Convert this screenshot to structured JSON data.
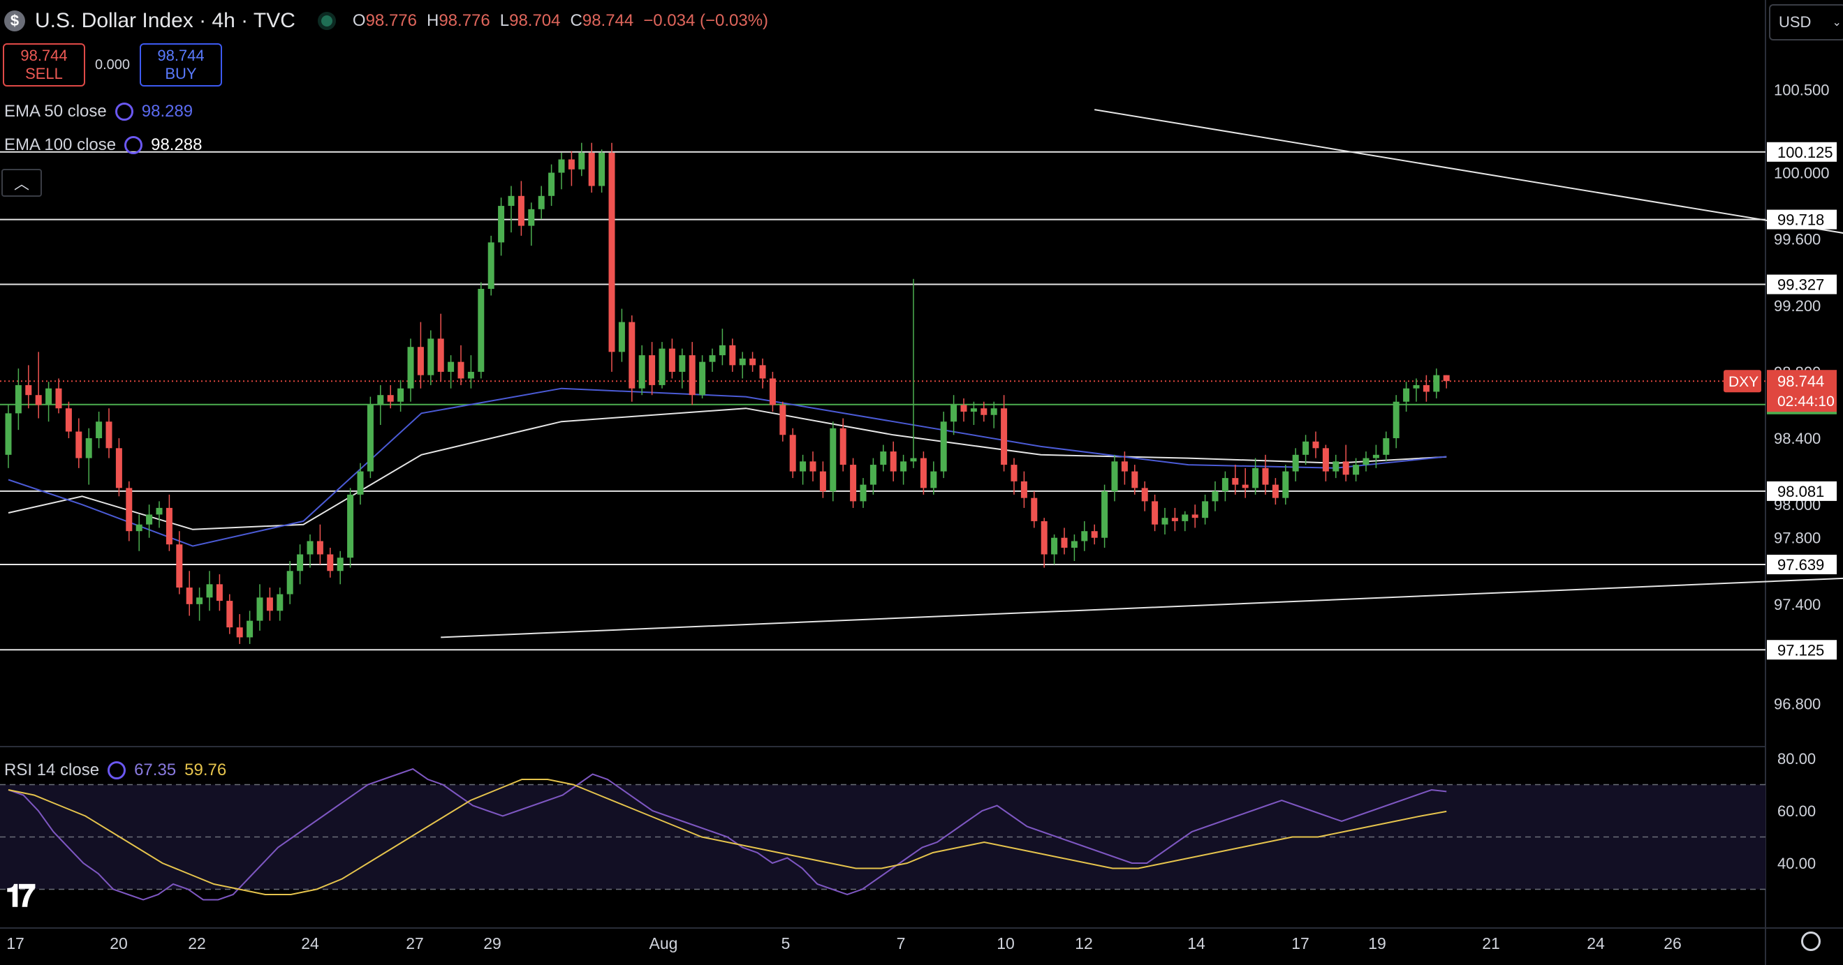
{
  "header": {
    "symbol_icon": "$",
    "title": "U.S. Dollar Index · 4h · TVC",
    "ohlc": {
      "o_label": "O",
      "o": "98.776",
      "h_label": "H",
      "h": "98.776",
      "l_label": "L",
      "l": "98.704",
      "c_label": "C",
      "c": "98.744",
      "change": "−0.034 (−0.03%)"
    }
  },
  "trade": {
    "sell_price": "98.744",
    "sell_label": "SELL",
    "spread": "0.000",
    "buy_price": "98.744",
    "buy_label": "BUY"
  },
  "indicators": {
    "ema50_label": "EMA 50 close",
    "ema50_value": "98.289",
    "ema100_label": "EMA 100 close",
    "ema100_value": "98.288",
    "rsi_label": "RSI 14 close",
    "rsi_value": "67.35",
    "rsi_ma_value": "59.76"
  },
  "currency_selector": "USD",
  "colors": {
    "background": "#000000",
    "up": "#4caf50",
    "down": "#ef5350",
    "ema50": "#4b5bd6",
    "ema100": "#e6e6e6",
    "rsi": "#7e57c2",
    "rsi_ma": "#e6c44d",
    "price_tag": "#e0473f",
    "level_green": "#4caf50"
  },
  "icons": [
    "dollar-icon",
    "market-status-icon",
    "refresh-icon",
    "chevron-up-icon",
    "tradingview-logo-icon",
    "settings-icon",
    "chevron-down-icon"
  ],
  "chart_data": {
    "type": "candlestick",
    "title": "U.S. Dollar Index · 4h · TVC",
    "symbol": "DXY",
    "x_ticks": [
      "17",
      "20",
      "22",
      "24",
      "27",
      "29",
      "Aug",
      "5",
      "7",
      "10",
      "12",
      "14",
      "17",
      "19",
      "21",
      "24",
      "26"
    ],
    "y_ticks": [
      "96.800",
      "97.400",
      "97.800",
      "98.000",
      "98.400",
      "98.800",
      "99.200",
      "99.600",
      "100.000",
      "100.500"
    ],
    "ylim": [
      96.55,
      100.78
    ],
    "horizontal_levels": [
      100.125,
      99.718,
      99.327,
      98.081,
      97.639,
      97.125
    ],
    "support_level_green": 98.603,
    "last_price": 98.744,
    "countdown": "02:44:10",
    "candles": [
      [
        98.3,
        98.6,
        98.22,
        98.55
      ],
      [
        98.55,
        98.82,
        98.45,
        98.72
      ],
      [
        98.72,
        98.84,
        98.58,
        98.66
      ],
      [
        98.66,
        98.92,
        98.52,
        98.6
      ],
      [
        98.6,
        98.74,
        98.5,
        98.7
      ],
      [
        98.7,
        98.76,
        98.55,
        98.58
      ],
      [
        98.58,
        98.62,
        98.4,
        98.44
      ],
      [
        98.44,
        98.52,
        98.22,
        98.28
      ],
      [
        98.28,
        98.46,
        98.12,
        98.4
      ],
      [
        98.4,
        98.56,
        98.34,
        98.5
      ],
      [
        98.5,
        98.58,
        98.28,
        98.34
      ],
      [
        98.34,
        98.4,
        98.05,
        98.1
      ],
      [
        98.1,
        98.14,
        97.78,
        97.84
      ],
      [
        97.84,
        97.94,
        97.72,
        97.88
      ],
      [
        97.88,
        98.0,
        97.8,
        97.94
      ],
      [
        97.94,
        98.02,
        97.86,
        97.98
      ],
      [
        97.98,
        98.06,
        97.72,
        97.76
      ],
      [
        97.76,
        97.84,
        97.46,
        97.5
      ],
      [
        97.5,
        97.6,
        97.33,
        97.4
      ],
      [
        97.4,
        97.5,
        97.3,
        97.44
      ],
      [
        97.44,
        97.6,
        97.36,
        97.52
      ],
      [
        97.52,
        97.58,
        97.36,
        97.42
      ],
      [
        97.42,
        97.46,
        97.22,
        97.26
      ],
      [
        97.26,
        97.34,
        97.16,
        97.2
      ],
      [
        97.2,
        97.36,
        97.16,
        97.3
      ],
      [
        97.3,
        97.52,
        97.24,
        97.44
      ],
      [
        97.44,
        97.5,
        97.3,
        97.36
      ],
      [
        97.36,
        97.5,
        97.3,
        97.46
      ],
      [
        97.46,
        97.66,
        97.4,
        97.6
      ],
      [
        97.6,
        97.76,
        97.52,
        97.7
      ],
      [
        97.7,
        97.82,
        97.62,
        97.78
      ],
      [
        97.78,
        97.88,
        97.64,
        97.7
      ],
      [
        97.7,
        97.74,
        97.56,
        97.6
      ],
      [
        97.6,
        97.72,
        97.52,
        97.68
      ],
      [
        97.68,
        98.1,
        97.62,
        98.06
      ],
      [
        98.06,
        98.25,
        98.0,
        98.2
      ],
      [
        98.2,
        98.65,
        98.16,
        98.6
      ],
      [
        98.6,
        98.72,
        98.48,
        98.66
      ],
      [
        98.66,
        98.72,
        98.58,
        98.62
      ],
      [
        98.62,
        98.75,
        98.56,
        98.7
      ],
      [
        98.7,
        99.0,
        98.62,
        98.95
      ],
      [
        98.95,
        99.1,
        98.7,
        98.78
      ],
      [
        98.78,
        99.05,
        98.72,
        99.0
      ],
      [
        99.0,
        99.15,
        98.74,
        98.8
      ],
      [
        98.8,
        98.9,
        98.7,
        98.86
      ],
      [
        98.86,
        98.96,
        98.72,
        98.76
      ],
      [
        98.76,
        98.9,
        98.7,
        98.8
      ],
      [
        98.8,
        99.34,
        98.76,
        99.3
      ],
      [
        99.3,
        99.62,
        99.26,
        99.58
      ],
      [
        99.58,
        99.85,
        99.5,
        99.8
      ],
      [
        99.8,
        99.92,
        99.64,
        99.86
      ],
      [
        99.86,
        99.95,
        99.62,
        99.68
      ],
      [
        99.68,
        99.82,
        99.56,
        99.78
      ],
      [
        99.78,
        99.92,
        99.72,
        99.86
      ],
      [
        99.86,
        100.05,
        99.8,
        100.0
      ],
      [
        100.0,
        100.12,
        99.9,
        100.08
      ],
      [
        100.08,
        100.13,
        99.92,
        100.02
      ],
      [
        100.02,
        100.18,
        99.98,
        100.12
      ],
      [
        100.12,
        100.18,
        99.88,
        99.92
      ],
      [
        99.92,
        100.14,
        99.88,
        100.12
      ],
      [
        100.12,
        100.18,
        98.8,
        98.92
      ],
      [
        98.92,
        99.18,
        98.86,
        99.1
      ],
      [
        99.1,
        99.14,
        98.62,
        98.7
      ],
      [
        98.7,
        98.96,
        98.66,
        98.9
      ],
      [
        98.9,
        98.98,
        98.66,
        98.72
      ],
      [
        98.72,
        98.98,
        98.7,
        98.94
      ],
      [
        98.94,
        99.0,
        98.76,
        98.8
      ],
      [
        98.8,
        98.94,
        98.7,
        98.9
      ],
      [
        98.9,
        98.98,
        98.6,
        98.66
      ],
      [
        98.66,
        98.9,
        98.64,
        98.86
      ],
      [
        98.86,
        98.94,
        98.8,
        98.9
      ],
      [
        98.9,
        99.06,
        98.84,
        98.96
      ],
      [
        98.96,
        99.0,
        98.8,
        98.84
      ],
      [
        98.84,
        98.92,
        98.76,
        98.88
      ],
      [
        98.88,
        98.92,
        98.8,
        98.84
      ],
      [
        98.84,
        98.88,
        98.7,
        98.76
      ],
      [
        98.76,
        98.8,
        98.56,
        98.6
      ],
      [
        98.6,
        98.62,
        98.38,
        98.42
      ],
      [
        98.42,
        98.46,
        98.16,
        98.2
      ],
      [
        98.2,
        98.3,
        98.12,
        98.26
      ],
      [
        98.26,
        98.32,
        98.14,
        98.2
      ],
      [
        98.2,
        98.26,
        98.04,
        98.08
      ],
      [
        98.08,
        98.5,
        98.02,
        98.46
      ],
      [
        98.46,
        98.52,
        98.2,
        98.24
      ],
      [
        98.24,
        98.28,
        97.98,
        98.02
      ],
      [
        98.02,
        98.16,
        97.98,
        98.12
      ],
      [
        98.12,
        98.28,
        98.06,
        98.24
      ],
      [
        98.24,
        98.36,
        98.2,
        98.32
      ],
      [
        98.32,
        98.38,
        98.14,
        98.2
      ],
      [
        98.2,
        98.3,
        98.12,
        98.26
      ],
      [
        98.26,
        99.36,
        98.22,
        98.28
      ],
      [
        98.28,
        98.32,
        98.06,
        98.1
      ],
      [
        98.1,
        98.26,
        98.06,
        98.2
      ],
      [
        98.2,
        98.56,
        98.16,
        98.5
      ],
      [
        98.5,
        98.66,
        98.42,
        98.6
      ],
      [
        98.6,
        98.64,
        98.5,
        98.56
      ],
      [
        98.56,
        98.62,
        98.48,
        98.58
      ],
      [
        98.58,
        98.62,
        98.5,
        98.54
      ],
      [
        98.54,
        98.62,
        98.46,
        98.58
      ],
      [
        98.58,
        98.66,
        98.2,
        98.24
      ],
      [
        98.24,
        98.28,
        98.06,
        98.14
      ],
      [
        98.14,
        98.2,
        97.98,
        98.04
      ],
      [
        98.04,
        98.08,
        97.86,
        97.9
      ],
      [
        97.9,
        97.92,
        97.62,
        97.7
      ],
      [
        97.7,
        97.82,
        97.64,
        97.8
      ],
      [
        97.8,
        97.86,
        97.7,
        97.74
      ],
      [
        97.74,
        97.82,
        97.66,
        97.78
      ],
      [
        97.78,
        97.9,
        97.72,
        97.84
      ],
      [
        97.84,
        97.88,
        97.76,
        97.8
      ],
      [
        97.8,
        98.12,
        97.74,
        98.08
      ],
      [
        98.08,
        98.3,
        98.02,
        98.26
      ],
      [
        98.26,
        98.32,
        98.12,
        98.2
      ],
      [
        98.2,
        98.24,
        98.06,
        98.1
      ],
      [
        98.1,
        98.14,
        97.96,
        98.02
      ],
      [
        98.02,
        98.06,
        97.84,
        97.88
      ],
      [
        97.88,
        97.98,
        97.82,
        97.92
      ],
      [
        97.92,
        97.98,
        97.84,
        97.9
      ],
      [
        97.9,
        97.96,
        97.84,
        97.94
      ],
      [
        97.94,
        98.0,
        97.86,
        97.92
      ],
      [
        97.92,
        98.06,
        97.88,
        98.02
      ],
      [
        98.02,
        98.14,
        97.96,
        98.08
      ],
      [
        98.08,
        98.2,
        98.02,
        98.16
      ],
      [
        98.16,
        98.24,
        98.06,
        98.12
      ],
      [
        98.12,
        98.22,
        98.04,
        98.1
      ],
      [
        98.1,
        98.28,
        98.06,
        98.22
      ],
      [
        98.22,
        98.3,
        98.06,
        98.12
      ],
      [
        98.12,
        98.16,
        98.0,
        98.04
      ],
      [
        98.04,
        98.24,
        98.0,
        98.2
      ],
      [
        98.2,
        98.34,
        98.14,
        98.3
      ],
      [
        98.3,
        98.42,
        98.24,
        98.38
      ],
      [
        98.38,
        98.44,
        98.28,
        98.34
      ],
      [
        98.34,
        98.36,
        98.14,
        98.2
      ],
      [
        98.2,
        98.3,
        98.16,
        98.26
      ],
      [
        98.26,
        98.36,
        98.14,
        98.18
      ],
      [
        98.18,
        98.28,
        98.14,
        98.24
      ],
      [
        98.24,
        98.32,
        98.2,
        98.28
      ],
      [
        98.28,
        98.36,
        98.22,
        98.3
      ],
      [
        98.3,
        98.44,
        98.26,
        98.4
      ],
      [
        98.4,
        98.66,
        98.34,
        98.62
      ],
      [
        98.62,
        98.74,
        98.56,
        98.7
      ],
      [
        98.7,
        98.76,
        98.62,
        98.72
      ],
      [
        98.72,
        98.78,
        98.62,
        98.68
      ],
      [
        98.68,
        98.82,
        98.64,
        98.78
      ],
      [
        98.78,
        98.78,
        98.7,
        98.744
      ]
    ],
    "ema50": [
      [
        0,
        98.15
      ],
      [
        20,
        98.0
      ],
      [
        50,
        97.75
      ],
      [
        80,
        97.9
      ],
      [
        112,
        98.55
      ],
      [
        150,
        98.7
      ],
      [
        200,
        98.65
      ],
      [
        240,
        98.5
      ],
      [
        280,
        98.35
      ],
      [
        320,
        98.24
      ],
      [
        360,
        98.22
      ],
      [
        390,
        98.289
      ]
    ],
    "ema100": [
      [
        0,
        97.95
      ],
      [
        20,
        98.05
      ],
      [
        50,
        97.85
      ],
      [
        80,
        97.88
      ],
      [
        112,
        98.3
      ],
      [
        150,
        98.5
      ],
      [
        200,
        98.58
      ],
      [
        240,
        98.42
      ],
      [
        280,
        98.3
      ],
      [
        320,
        98.28
      ],
      [
        360,
        98.25
      ],
      [
        390,
        98.288
      ]
    ],
    "trendlines": [
      {
        "from": [
          108,
          100.38
        ],
        "to": [
          372,
          97.66
        ]
      },
      {
        "from": [
          43,
          97.2
        ],
        "to": [
          372,
          98.06
        ]
      }
    ],
    "rsi": {
      "ylim": [
        16,
        84
      ],
      "ticks": [
        "40.00",
        "60.00",
        "80.00"
      ],
      "bands": [
        30,
        50,
        70
      ],
      "values": [
        68,
        66,
        60,
        52,
        46,
        40,
        36,
        30,
        28,
        26,
        28,
        32,
        30,
        26,
        26,
        28,
        34,
        40,
        46,
        50,
        54,
        58,
        62,
        66,
        70,
        72,
        74,
        76,
        72,
        70,
        66,
        62,
        60,
        58,
        60,
        62,
        64,
        66,
        70,
        74,
        72,
        68,
        64,
        60,
        58,
        56,
        54,
        52,
        50,
        46,
        44,
        40,
        42,
        38,
        32,
        30,
        28,
        30,
        34,
        38,
        42,
        46,
        48,
        52,
        56,
        60,
        62,
        58,
        54,
        52,
        50,
        48,
        46,
        44,
        42,
        40,
        40,
        44,
        48,
        52,
        54,
        56,
        58,
        60,
        62,
        64,
        62,
        60,
        58,
        56,
        58,
        60,
        62,
        64,
        66,
        68,
        67.35
      ],
      "ma_values": [
        68,
        66,
        62,
        58,
        52,
        46,
        40,
        36,
        32,
        30,
        28,
        28,
        30,
        34,
        40,
        46,
        52,
        58,
        64,
        68,
        72,
        72,
        70,
        66,
        62,
        58,
        54,
        50,
        48,
        46,
        44,
        42,
        40,
        38,
        38,
        40,
        44,
        46,
        48,
        46,
        44,
        42,
        40,
        38,
        38,
        40,
        42,
        44,
        46,
        48,
        50,
        50,
        52,
        54,
        56,
        58,
        59.76
      ]
    }
  }
}
